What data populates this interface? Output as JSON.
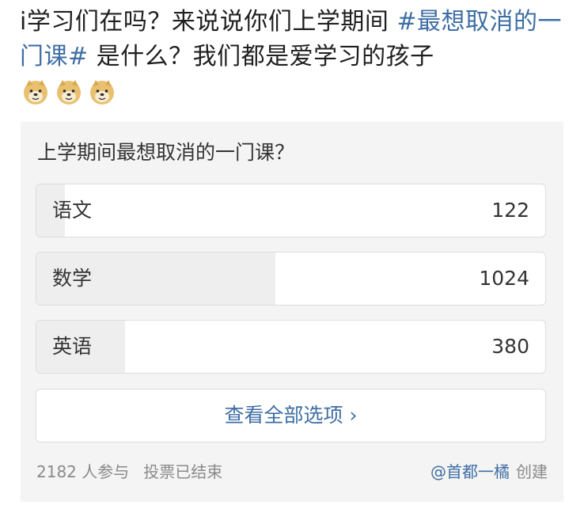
{
  "post": {
    "text_prefix": "i学习们在吗？来说说你们上学期间 ",
    "hashtag": "#最想取消的一门课#",
    "text_suffix": " 是什么？我们都是爱学习的孩子",
    "emoji_count": 3
  },
  "poll": {
    "title": "上学期间最想取消的一门课？",
    "options": [
      {
        "label": "语文",
        "count": "122",
        "share": 0.056
      },
      {
        "label": "数学",
        "count": "1024",
        "share": 0.469
      },
      {
        "label": "英语",
        "count": "380",
        "share": 0.174
      }
    ],
    "view_all_label": "查看全部选项 ›",
    "participants": "2182 人参与",
    "status": "投票已结束",
    "creator": "@首都一橘",
    "created_label": "创建"
  },
  "colors": {
    "link": "#3f6ea3",
    "fill": "#eeeeee",
    "card_bg": "#f4f4f4"
  },
  "icons": {
    "emoji": "doge-emoji-icon"
  }
}
